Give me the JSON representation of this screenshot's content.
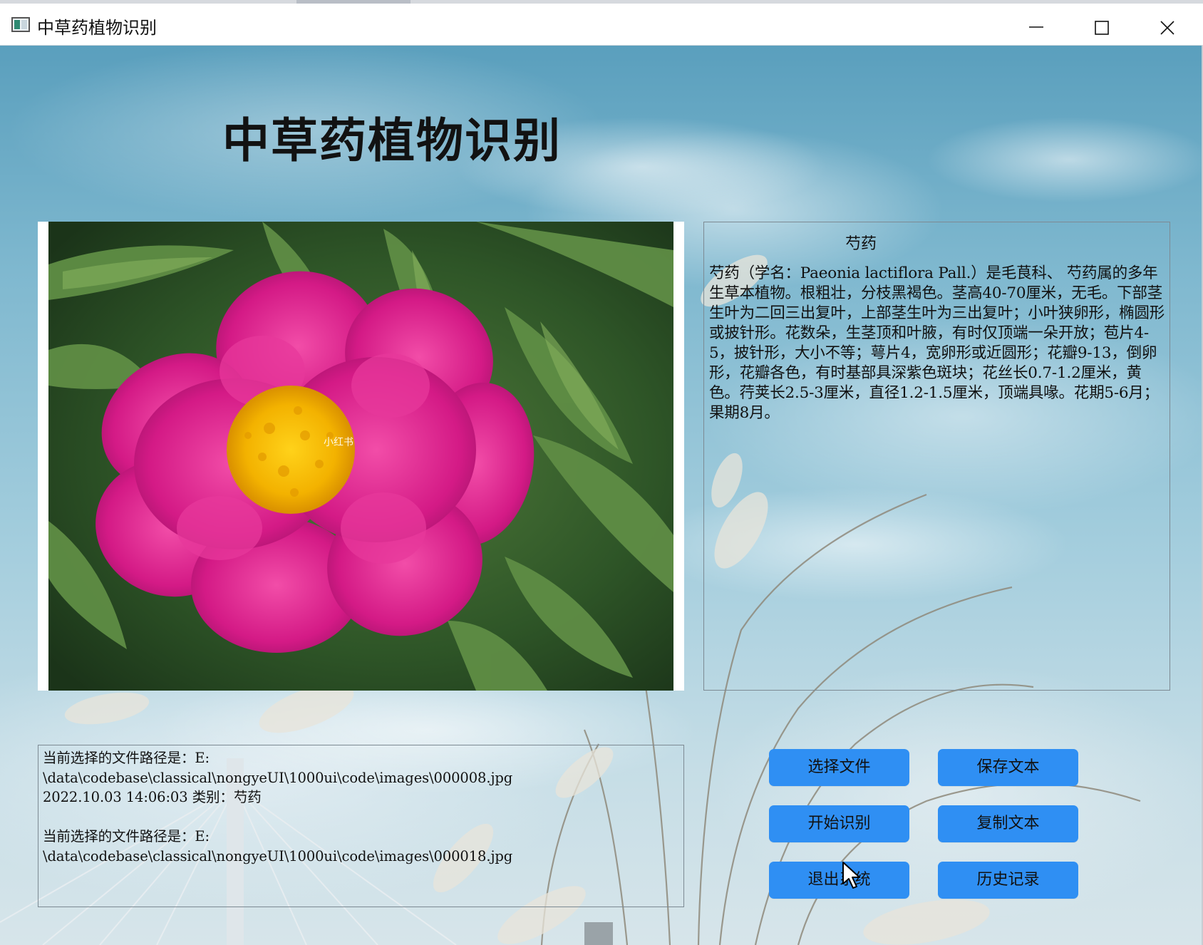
{
  "window": {
    "title": "中草药植物识别",
    "icon": "app-window-icon",
    "controls": [
      "minimize-icon",
      "maximize-icon",
      "close-icon"
    ]
  },
  "main": {
    "title": "中草药植物识别"
  },
  "image_panel": {
    "subject": "pink peony flower photo",
    "watermark": "小红书"
  },
  "description": {
    "name": "芍药",
    "text": "芍药（学名：Paeonia lactiflora Pall.）是毛茛科、 芍药属的多年生草本植物。根粗壮，分枝黑褐色。茎高40-70厘米，无毛。下部茎生叶为二回三出复叶，上部茎生叶为三出复叶；小叶狭卵形，椭圆形或披针形。花数朵，生茎顶和叶腋，有时仅顶端一朵开放；苞片4-5，披针形，大小不等；萼片4，宽卵形或近圆形；花瓣9-13，倒卵形，花瓣各色，有时基部具深紫色斑块；花丝长0.7-1.2厘米，黄色。荇荚长2.5-3厘米，直径1.2-1.5厘米，顶端具喙。花期5-6月；果期8月。"
  },
  "log": {
    "text": "当前选择的文件路径是：E:\n\\data\\codebase\\classical\\nongyeUI\\1000ui\\code\\images\\000008.jpg\n2022.10.03 14:06:03 类别：芍药\n\n当前选择的文件路径是：E:\n\\data\\codebase\\classical\\nongyeUI\\1000ui\\code\\images\\000018.jpg"
  },
  "buttons": {
    "select_file": "选择文件",
    "save_text": "保存文本",
    "start_recognition": "开始识别",
    "copy_text": "复制文本",
    "exit_system": "退出系统",
    "history": "历史记录"
  },
  "colors": {
    "button": "#2f8ff3",
    "sky_top": "#5a9fbd",
    "sky_bottom": "#d7e5ea"
  }
}
